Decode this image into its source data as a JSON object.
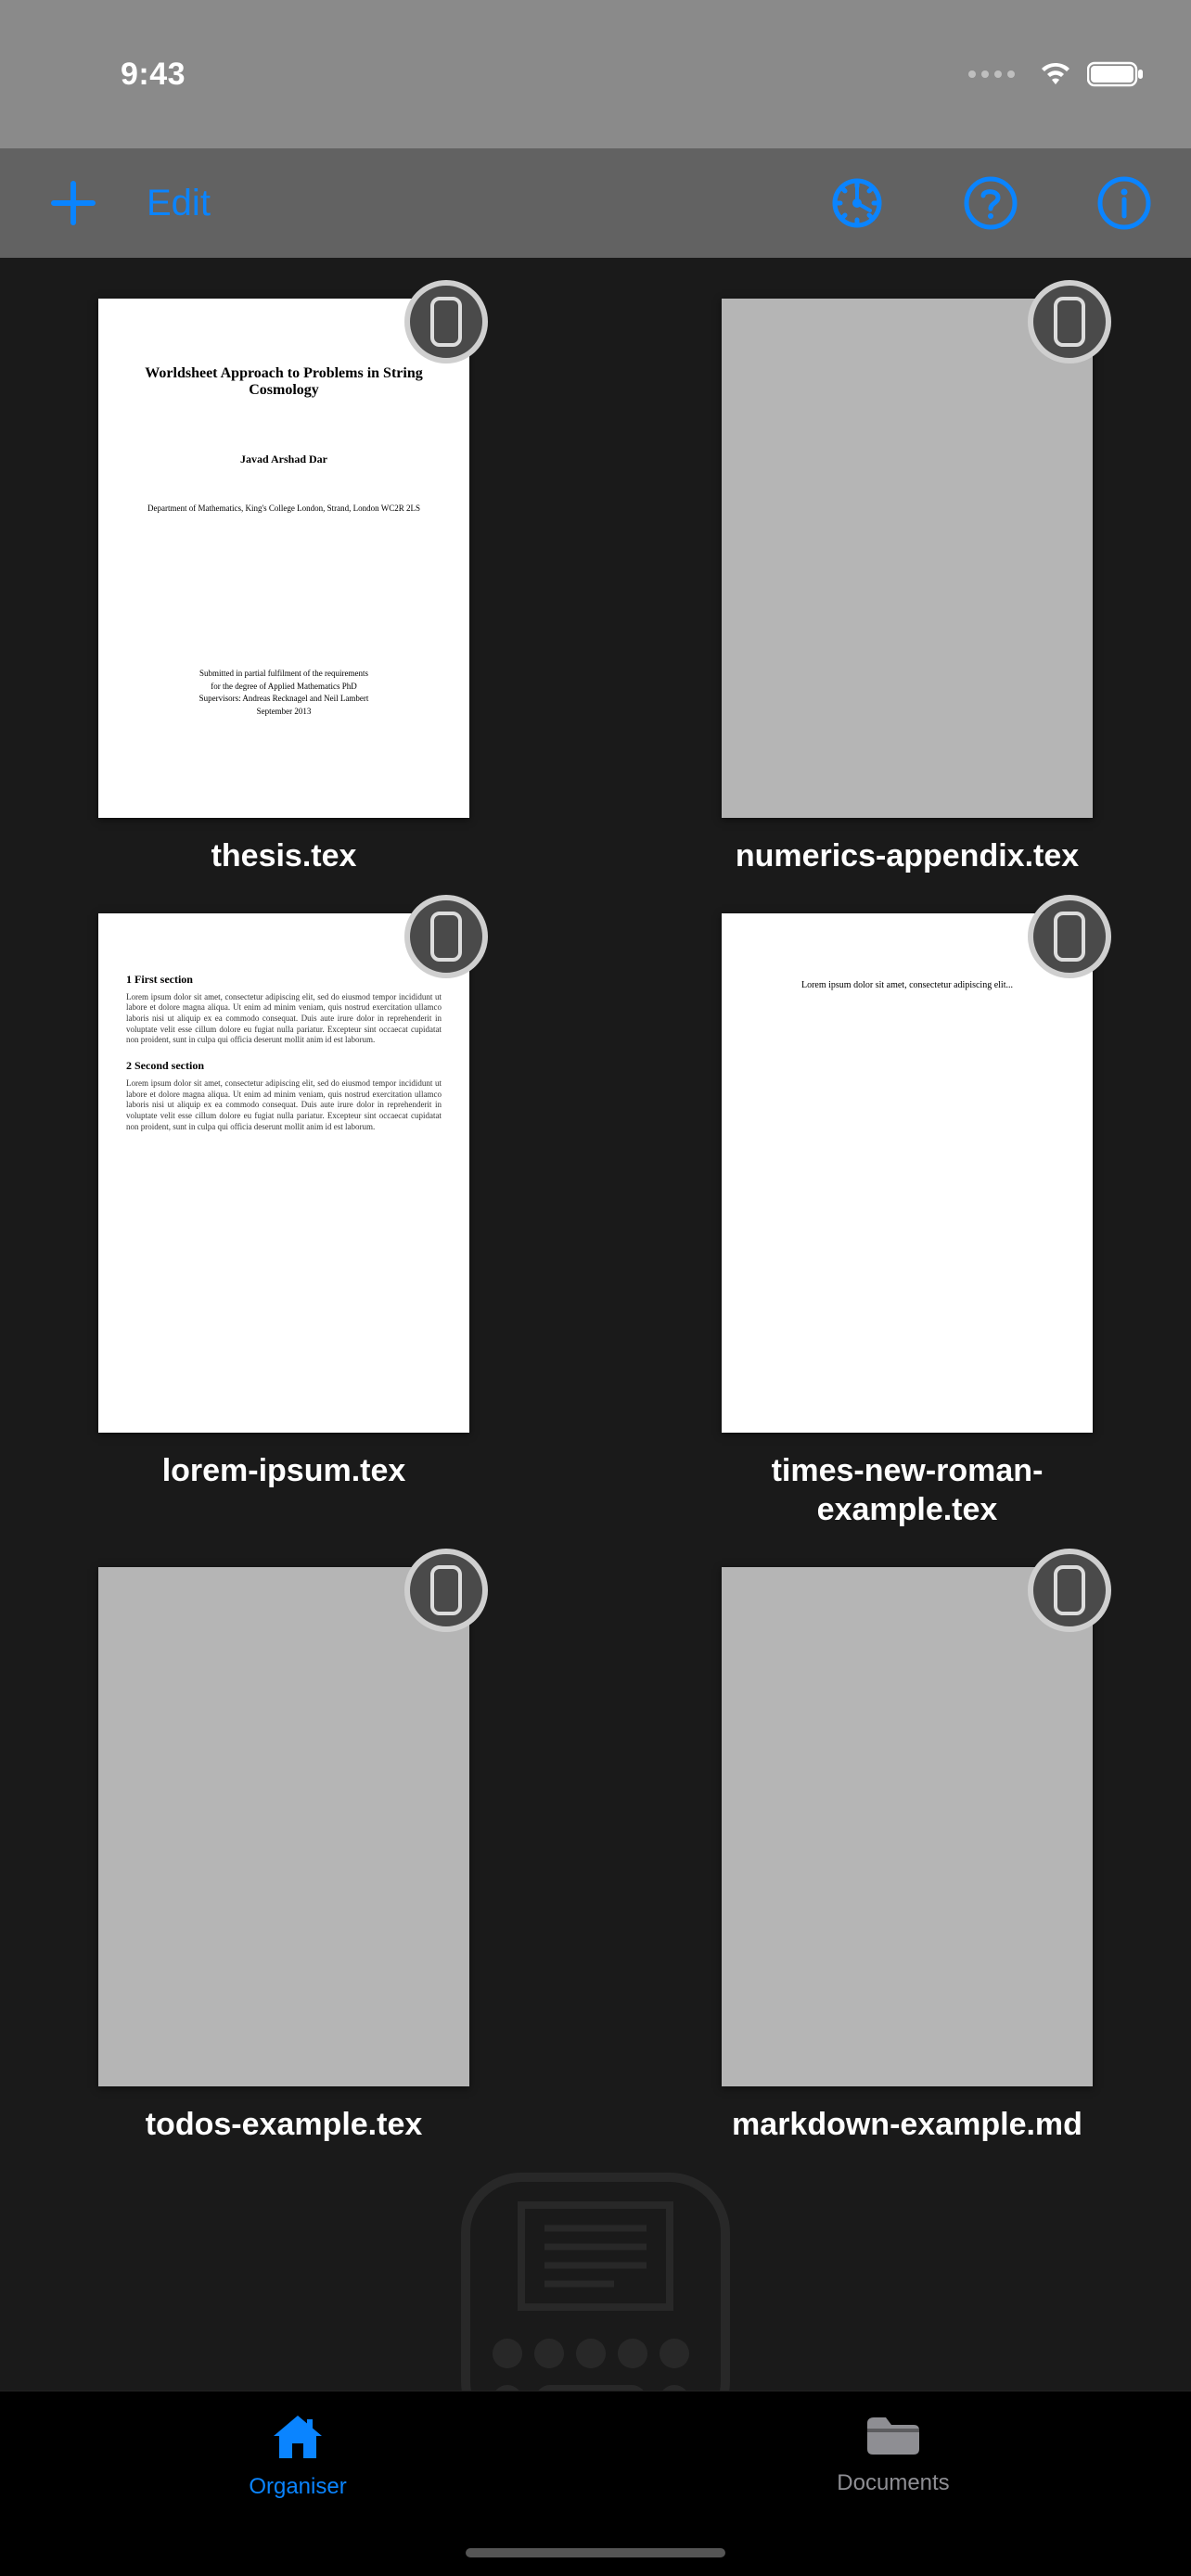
{
  "status": {
    "time": "9:43"
  },
  "nav": {
    "edit_label": "Edit"
  },
  "docs": [
    {
      "name": "thesis.tex",
      "preview": {
        "kind": "thesis",
        "title": "Worldsheet Approach to Problems in String Cosmology",
        "author": "Javad Arshad Dar",
        "dept": "Department of Mathematics, King's College London, Strand, London WC2R 2LS",
        "sub1": "Submitted in partial fulfilment of the requirements",
        "sub2": "for the degree of Applied Mathematics PhD",
        "sub3": "Supervisors: Andreas Recknagel and Neil Lambert",
        "sub4": "September 2013"
      }
    },
    {
      "name": "numerics-appendix.tex",
      "preview": {
        "kind": "blank-gray"
      }
    },
    {
      "name": "lorem-ipsum.tex",
      "preview": {
        "kind": "lorem",
        "h1": "1   First section",
        "p1": "Lorem ipsum dolor sit amet, consectetur adipiscing elit, sed do eiusmod tempor incididunt ut labore et dolore magna aliqua. Ut enim ad minim veniam, quis nostrud exercitation ullamco laboris nisi ut aliquip ex ea commodo consequat. Duis aute irure dolor in reprehenderit in voluptate velit esse cillum dolore eu fugiat nulla pariatur. Excepteur sint occaecat cupidatat non proident, sunt in culpa qui officia deserunt mollit anim id est laborum.",
        "h2": "2   Second section",
        "p2": "Lorem ipsum dolor sit amet, consectetur adipiscing elit, sed do eiusmod tempor incididunt ut labore et dolore magna aliqua. Ut enim ad minim veniam, quis nostrud exercitation ullamco laboris nisi ut aliquip ex ea commodo consequat. Duis aute irure dolor in reprehenderit in voluptate velit esse cillum dolore eu fugiat nulla pariatur. Excepteur sint occaecat cupidatat non proident, sunt in culpa qui officia deserunt mollit anim id est laborum."
      }
    },
    {
      "name": "times-new-roman-example.tex",
      "preview": {
        "kind": "times",
        "line": "Lorem ipsum dolor sit amet, consectetur adipiscing elit..."
      }
    },
    {
      "name": "todos-example.tex",
      "preview": {
        "kind": "blank-gray"
      }
    },
    {
      "name": "markdown-example.md",
      "preview": {
        "kind": "blank-gray"
      }
    }
  ],
  "tabs": {
    "organiser": "Organiser",
    "documents": "Documents"
  }
}
